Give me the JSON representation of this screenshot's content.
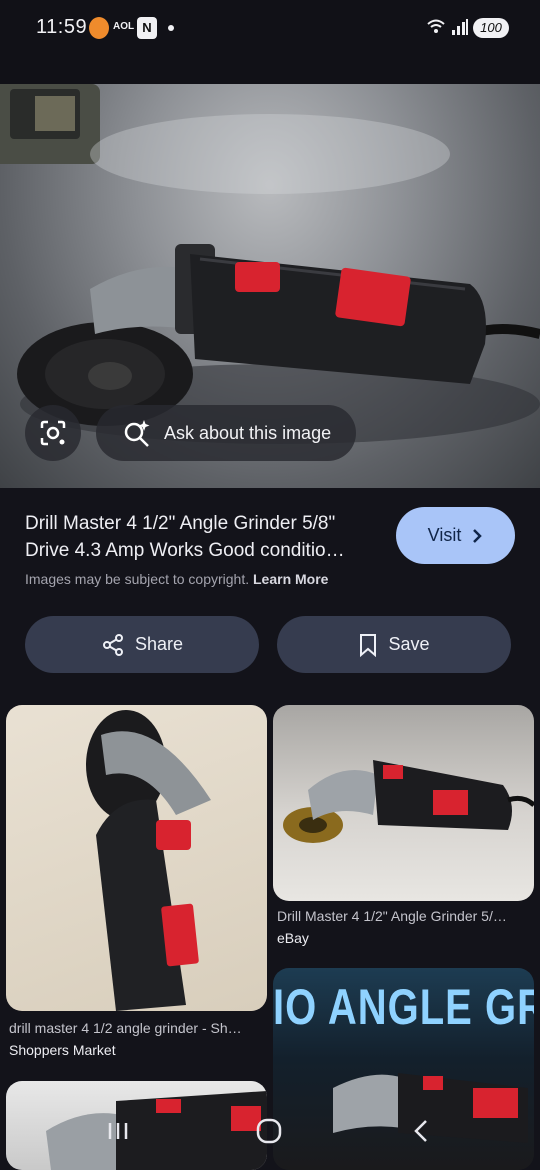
{
  "status_bar": {
    "time": "11:59",
    "notifications": [
      "burger-king-app-icon",
      "aol-app-icon",
      "news-app-icon",
      "more-notifications-dot"
    ],
    "aol_label": "AOL",
    "news_glyph": "N",
    "battery": "100"
  },
  "hero": {
    "ask_label": "Ask about this image"
  },
  "result": {
    "title": "Drill Master 4 1/2\" Angle Grinder 5/8\" Drive 4.3 Amp Works Good conditio…",
    "visit_label": "Visit",
    "copyright_text": "Images may be subject to copyright.",
    "learn_more": "Learn More",
    "share_label": "Share",
    "save_label": "Save"
  },
  "related": [
    {
      "caption": "drill master 4 1/2 angle grinder - Sh…",
      "source": "Shoppers Market"
    },
    {
      "caption": "Drill Master 4 1/2\" Angle Grinder 5/…",
      "source": "eBay"
    },
    {
      "banner": "IO ANGLE GRINDE"
    }
  ],
  "colors": {
    "background": "#13131a",
    "visit_button": "#a9c5f8",
    "pill_button": "#363c4f",
    "tool_red": "#d8232f"
  }
}
